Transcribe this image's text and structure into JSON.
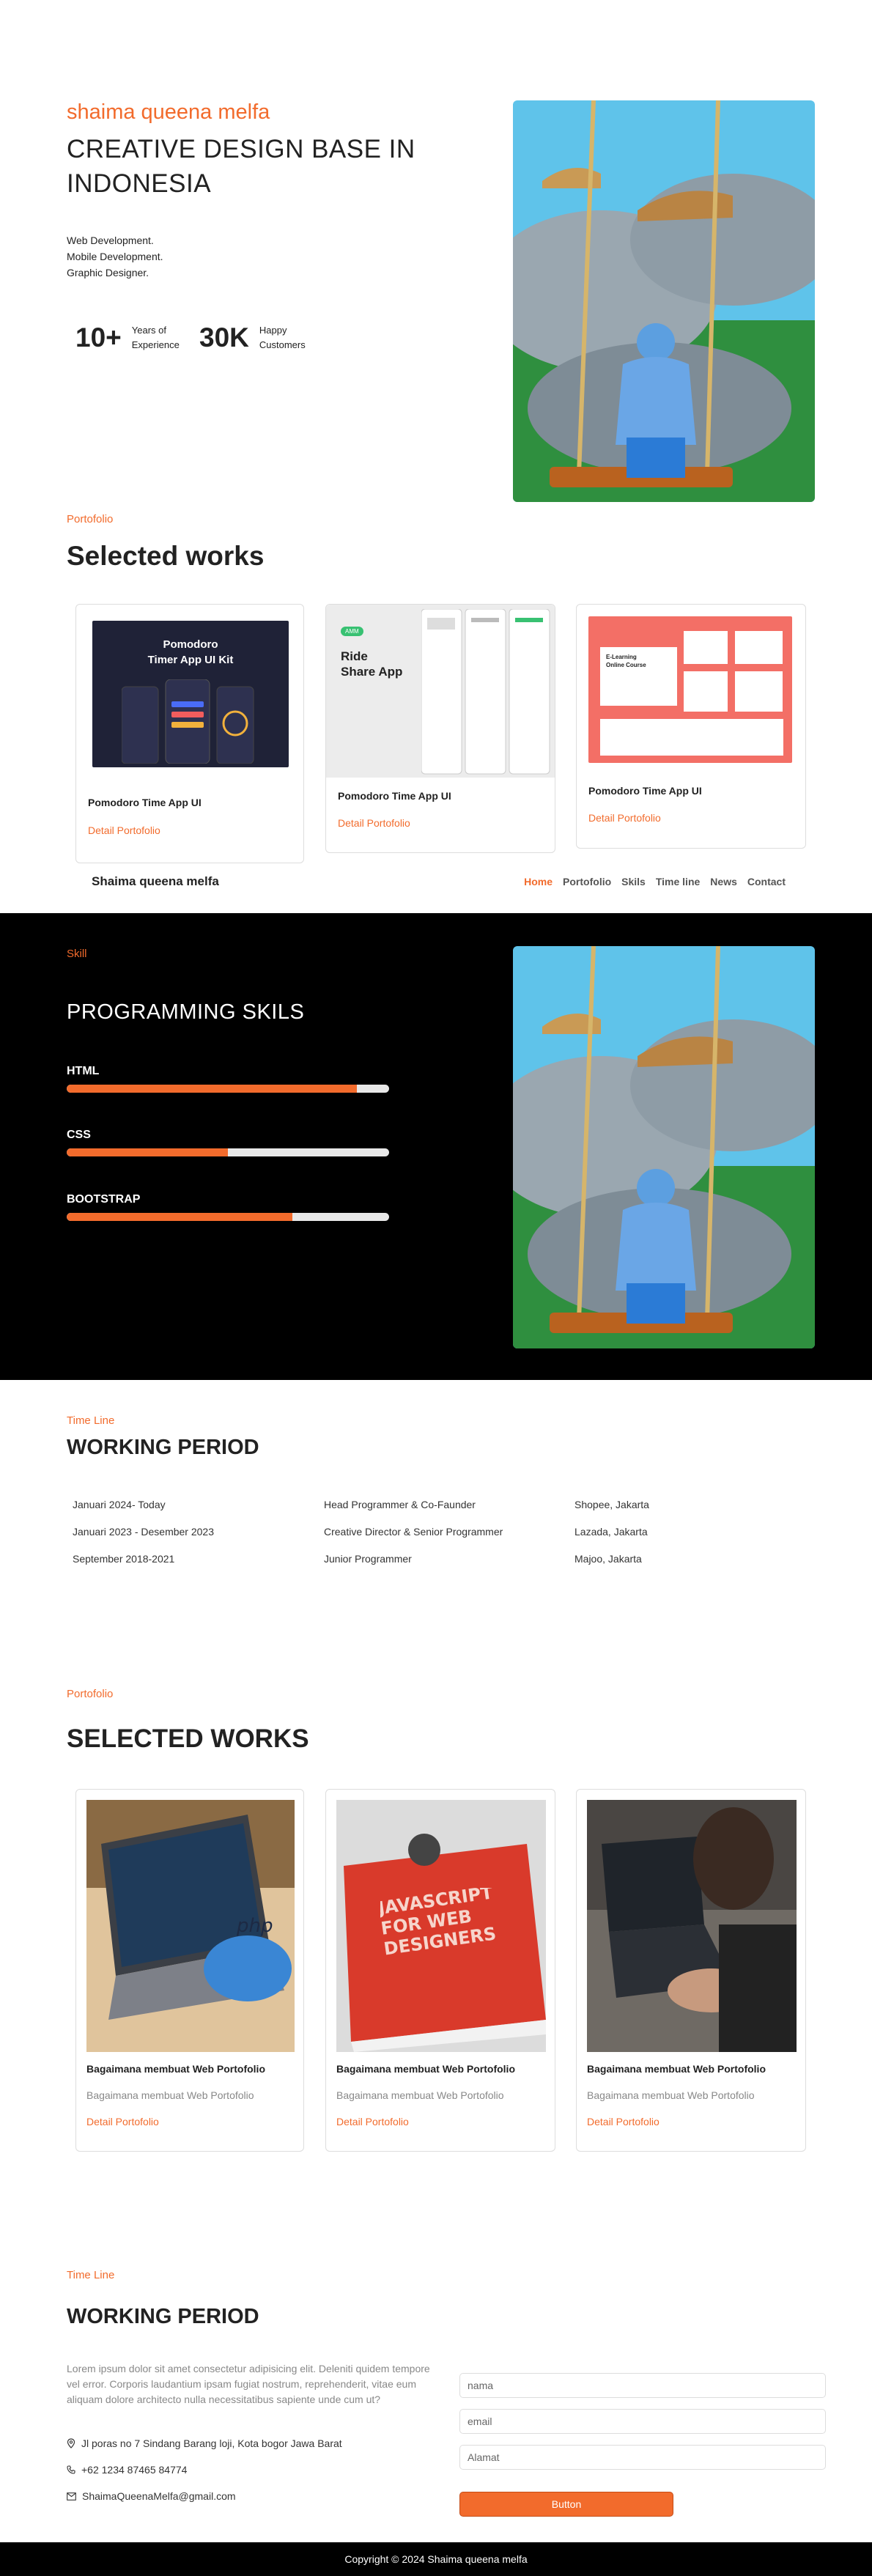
{
  "hero": {
    "name": "shaima queena melfa",
    "title": "CREATIVE DESIGN BASE IN INDONESIA",
    "skills": [
      "Web Development.",
      "Mobile Development.",
      "Graphic Designer."
    ],
    "stats": [
      {
        "number": "10+",
        "label_line1": "Years of",
        "label_line2": "Experience"
      },
      {
        "number": "30K",
        "label_line1": "Happy",
        "label_line2": "Customers"
      }
    ]
  },
  "portfolio": {
    "kicker": "Portofolio",
    "title": "Selected works",
    "cards": [
      {
        "title": "Pomodoro Time App UI",
        "link": "Detail Portofolio",
        "image_text_1": "Pomodoro",
        "image_text_2": "Timer App UI  Kit"
      },
      {
        "title": "Pomodoro Time App UI",
        "link": "Detail Portofolio",
        "image_text_1": "Ride",
        "image_text_2": "Share App"
      },
      {
        "title": "Pomodoro Time App UI",
        "link": "Detail Portofolio",
        "image_text_1": "E-Learning",
        "image_text_2": "Online Course"
      }
    ]
  },
  "nav": {
    "brand": "Shaima queena melfa",
    "links": [
      "Home",
      "Portofolio",
      "Skils",
      "Time line",
      "News",
      "Contact"
    ],
    "active": "Home"
  },
  "skill": {
    "kicker": "Skill",
    "title": "PROGRAMMING SKILS",
    "items": [
      {
        "label": "HTML",
        "percent": 90
      },
      {
        "label": "CSS",
        "percent": 50
      },
      {
        "label": "BOOTSTRAP",
        "percent": 70
      }
    ]
  },
  "timeline": {
    "kicker": "Time Line",
    "title": "WORKING PERIOD",
    "rows": [
      {
        "period": "Januari 2024- Today",
        "role": "Head Programmer & Co-Faunder",
        "company": "Shopee, Jakarta"
      },
      {
        "period": "Januari 2023 - Desember 2023",
        "role": "Creative Director & Senior Programmer",
        "company": "Lazada, Jakarta"
      },
      {
        "period": "September 2018-2021",
        "role": "Junior Programmer",
        "company": "Majoo, Jakarta"
      }
    ]
  },
  "works": {
    "kicker": "Portofolio",
    "title": "SELECTED WORKS",
    "cards": [
      {
        "title": "Bagaimana membuat Web Portofolio",
        "subtitle": "Bagaimana membuat Web Portofolio",
        "link": "Detail Portofolio",
        "image_text": "php"
      },
      {
        "title": "Bagaimana membuat Web Portofolio",
        "subtitle": "Bagaimana membuat Web Portofolio",
        "link": "Detail Portofolio",
        "image_text": "JAVASCRIPT FOR WEB DESIGNERS"
      },
      {
        "title": "Bagaimana membuat Web Portofolio",
        "subtitle": "Bagaimana membuat Web Portofolio",
        "link": "Detail Portofolio",
        "image_text": ""
      }
    ]
  },
  "contact": {
    "kicker": "Time Line",
    "title": "WORKING PERIOD",
    "text": "Lorem ipsum dolor sit amet consectetur adipisicing elit. Deleniti quidem tempore vel error. Corporis laudantium ipsam fugiat nostrum, reprehenderit, vitae eum aliquam dolore architecto nulla necessitatibus sapiente unde cum ut?",
    "address": "Jl poras no 7 Sindang Barang loji, Kota bogor Jawa Barat",
    "phone": "+62 1234 87465 84774",
    "email": "ShaimaQueenaMelfa@gmail.com",
    "form": {
      "name_placeholder": "nama",
      "email_placeholder": "email",
      "address_placeholder": "Alamat",
      "button": "Button"
    }
  },
  "footer": {
    "copyright": "Copyright © 2024 Shaima queena melfa"
  },
  "colors": {
    "accent": "#f26b2c",
    "dark": "#000000",
    "text": "#222222"
  }
}
